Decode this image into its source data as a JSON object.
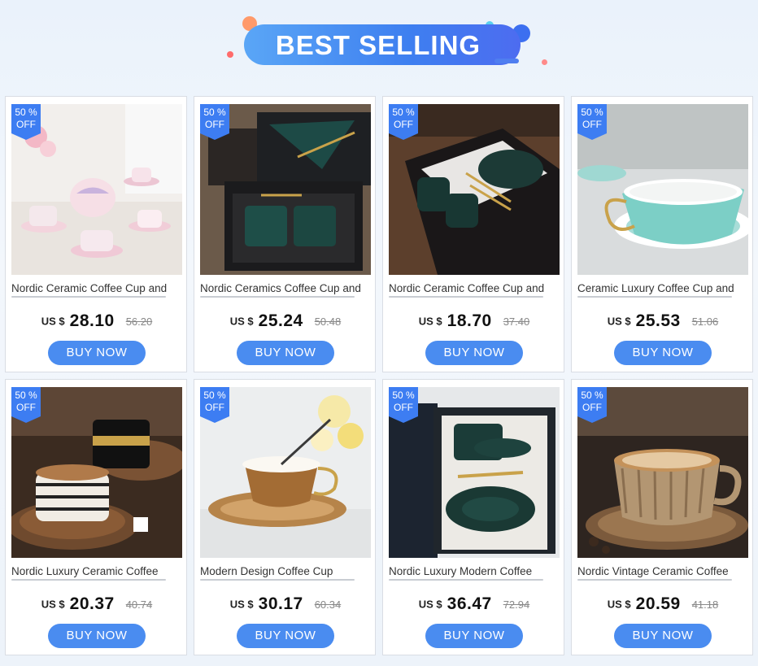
{
  "banner": {
    "title": "BEST SELLING"
  },
  "colors": {
    "accent": "#3d7df2",
    "button": "#4a8cf0"
  },
  "products": [
    {
      "badge_pct": "50 %",
      "badge_off": "OFF",
      "name": "Nordic Ceramic Coffee Cup and",
      "currency": "US $",
      "price": "28.10",
      "old_price": "56.20",
      "button": "BUY NOW"
    },
    {
      "badge_pct": "50 %",
      "badge_off": "OFF",
      "name": "Nordic Ceramics Coffee Cup and",
      "currency": "US $",
      "price": "25.24",
      "old_price": "50.48",
      "button": "BUY NOW"
    },
    {
      "badge_pct": "50 %",
      "badge_off": "OFF",
      "name": "Nordic Ceramic Coffee Cup and",
      "currency": "US $",
      "price": "18.70",
      "old_price": "37.40",
      "button": "BUY NOW"
    },
    {
      "badge_pct": "50 %",
      "badge_off": "OFF",
      "name": "Ceramic Luxury Coffee Cup and",
      "currency": "US $",
      "price": "25.53",
      "old_price": "51.06",
      "button": "BUY NOW"
    },
    {
      "badge_pct": "50 %",
      "badge_off": "OFF",
      "name": "Nordic Luxury Ceramic Coffee",
      "currency": "US $",
      "price": "20.37",
      "old_price": "40.74",
      "button": "BUY NOW"
    },
    {
      "badge_pct": "50 %",
      "badge_off": "OFF",
      "name": "Modern Design Coffee Cup",
      "currency": "US $",
      "price": "30.17",
      "old_price": "60.34",
      "button": "BUY NOW"
    },
    {
      "badge_pct": "50 %",
      "badge_off": "OFF",
      "name": "Nordic Luxury Modern Coffee",
      "currency": "US $",
      "price": "36.47",
      "old_price": "72.94",
      "button": "BUY NOW"
    },
    {
      "badge_pct": "50 %",
      "badge_off": "OFF",
      "name": "Nordic Vintage Ceramic Coffee",
      "currency": "US $",
      "price": "20.59",
      "old_price": "41.18",
      "button": "BUY NOW"
    }
  ]
}
